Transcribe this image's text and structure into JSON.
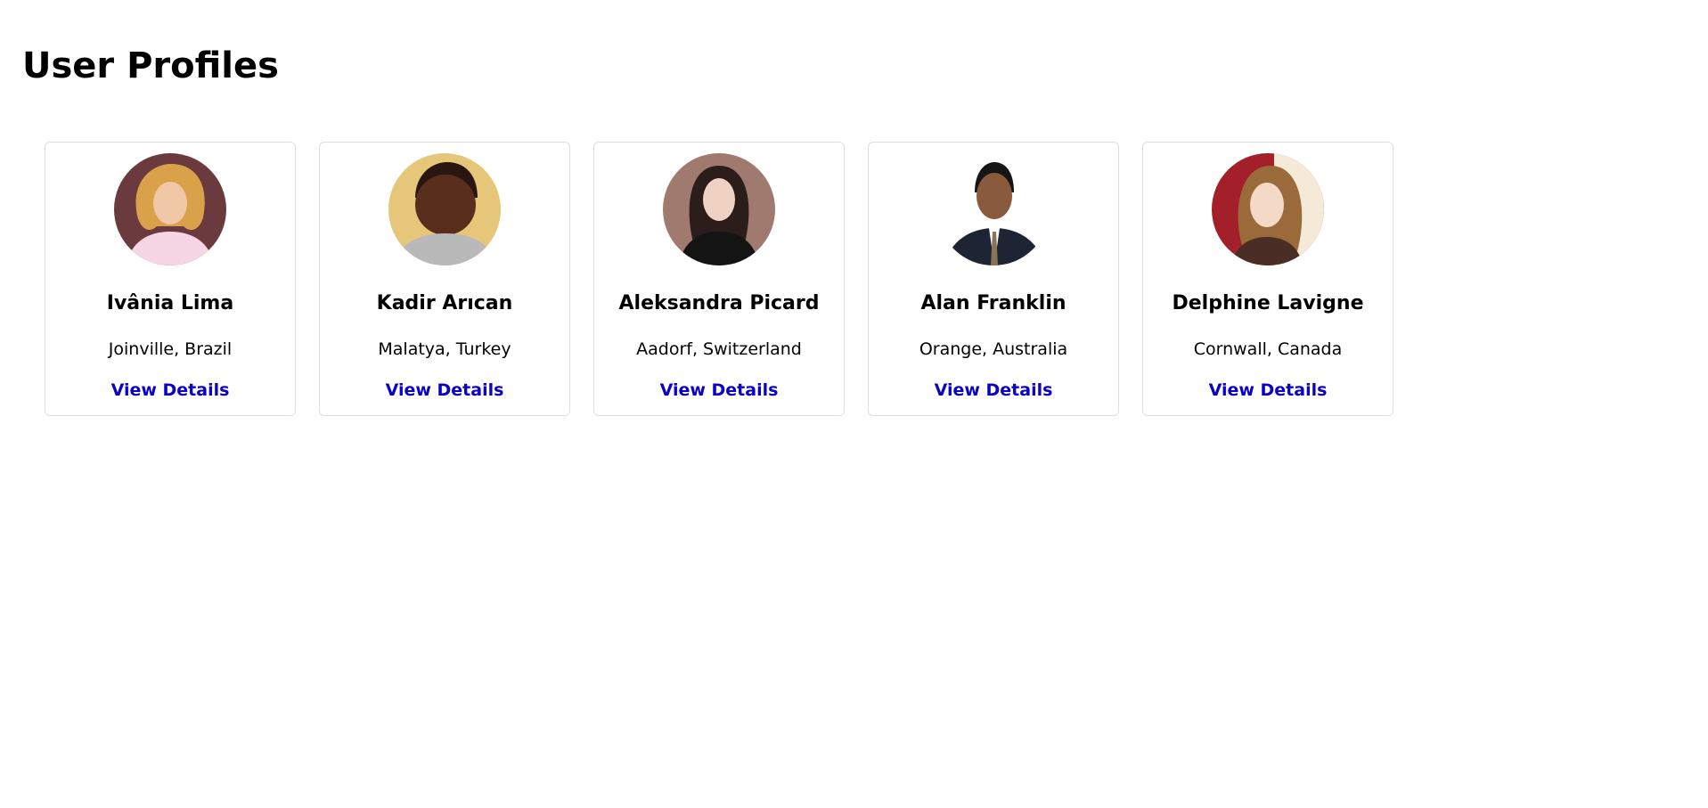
{
  "page": {
    "title": "User Profiles"
  },
  "theme": {
    "link_color": "#0a00c8",
    "card_border": "#dedede"
  },
  "profiles": [
    {
      "name": "Ivânia Lima",
      "location": "Joinville, Brazil",
      "link_label": "View Details",
      "photo": {
        "bg": "#6b3a3f",
        "skin": "#f0c8a8",
        "hair": "#d9a24a",
        "clothes": "#f6d6e4"
      }
    },
    {
      "name": "Kadir Arıcan",
      "location": "Malatya, Turkey",
      "link_label": "View Details",
      "photo": {
        "bg": "#e6c77a",
        "skin": "#5a2e1c",
        "hair": "#2a1610",
        "clothes": "#b9b9b9"
      }
    },
    {
      "name": "Aleksandra Picard",
      "location": "Aadorf, Switzerland",
      "link_label": "View Details",
      "photo": {
        "bg": "#a07a6e",
        "skin": "#f0d2c2",
        "hair": "#2b1d1a",
        "clothes": "#141414"
      }
    },
    {
      "name": "Alan Franklin",
      "location": "Orange, Australia",
      "link_label": "View Details",
      "photo": {
        "bg": "#ffffff",
        "skin": "#8a5a3c",
        "hair": "#151515",
        "clothes": "#1d2433"
      }
    },
    {
      "name": "Delphine Lavigne",
      "location": "Cornwall, Canada",
      "link_label": "View Details",
      "photo": {
        "bg": "#a3202a",
        "skin": "#f3d9c6",
        "hair": "#9a6a3a",
        "clothes": "#4a2e26"
      }
    }
  ]
}
